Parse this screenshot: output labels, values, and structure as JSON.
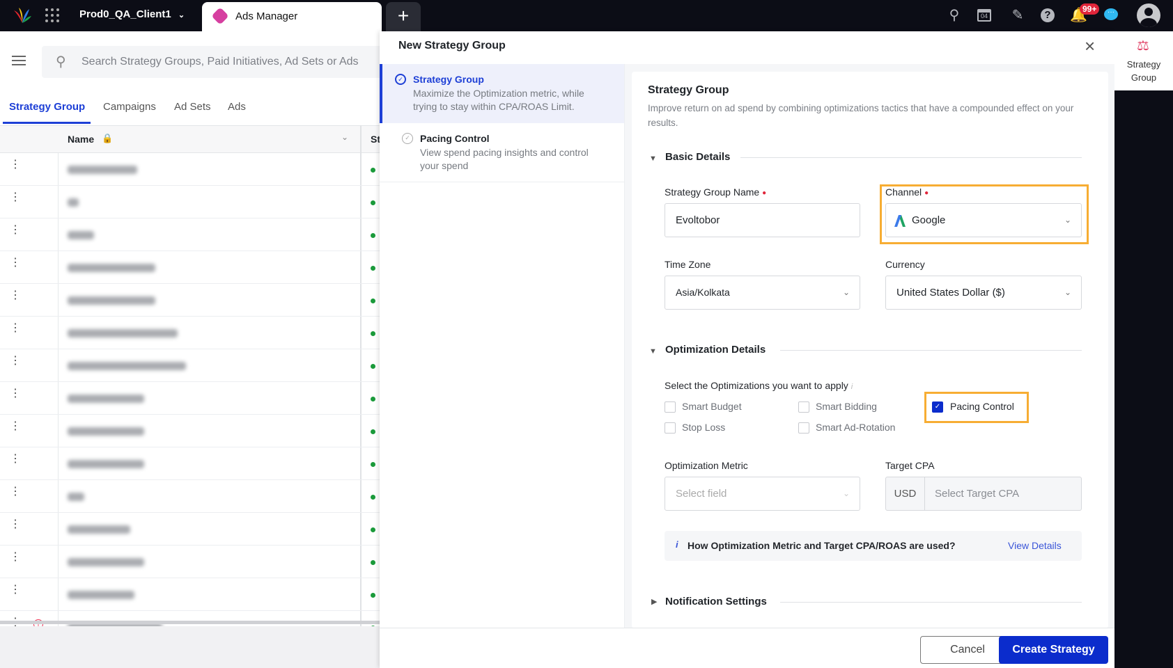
{
  "topbar": {
    "workspace": "Prod0_QA_Client1",
    "active_tab": "Ads Manager",
    "notification_badge": "99+",
    "calendar_day": "04",
    "icons": [
      "logo-icon",
      "apps-grid-icon",
      "search-icon",
      "calendar-icon",
      "pencil-icon",
      "help-icon",
      "bell-icon",
      "chat-icon",
      "avatar-icon"
    ]
  },
  "left": {
    "search_placeholder": "Search Strategy Groups, Paid Initiatives, Ad Sets or Ads",
    "tabs": [
      "Strategy Group",
      "Campaigns",
      "Ad Sets",
      "Ads"
    ],
    "active_tab": 0,
    "column_name": "Name",
    "column_status": "St",
    "row_count_visible": 15,
    "status_color": "#1a9a3a"
  },
  "modal": {
    "title": "New Strategy Group",
    "nav": [
      {
        "title": "Strategy Group",
        "desc": "Maximize the Optimization metric, while trying to stay within CPA/ROAS Limit.",
        "active": true
      },
      {
        "title": "Pacing Control",
        "desc": "View spend pacing insights and control your spend",
        "active": false
      }
    ],
    "card_title": "Strategy Group",
    "card_desc": "Improve return on ad spend by combining optimizations tactics that have a compounded effect on your results.",
    "basic_details": "Basic Details",
    "name_label": "Strategy Group Name",
    "name_value": "Evoltobor",
    "channel_label": "Channel",
    "channel_value": "Google",
    "timezone_label": "Time Zone",
    "timezone_value": "Asia/Kolkata",
    "currency_label": "Currency",
    "currency_value": "United States Dollar ($)",
    "optimization_details": "Optimization Details",
    "select_opts_label": "Select the Optimizations you want to apply",
    "options": [
      {
        "label": "Smart Budget",
        "checked": false
      },
      {
        "label": "Smart Bidding",
        "checked": false
      },
      {
        "label": "Pacing Control",
        "checked": true
      },
      {
        "label": "Stop Loss",
        "checked": false
      },
      {
        "label": "Smart Ad-Rotation",
        "checked": false
      }
    ],
    "metric_label": "Optimization Metric",
    "metric_placeholder": "Select field",
    "target_label": "Target CPA",
    "target_currency": "USD",
    "target_placeholder": "Select Target CPA",
    "info_text": "How Optimization Metric and Target CPA/ROAS are used?",
    "info_link": "View Details",
    "notification_settings": "Notification Settings",
    "cancel": "Cancel",
    "create": "Create Strategy"
  },
  "right_rail": {
    "label": "Strategy Group"
  },
  "colors": {
    "accent": "#0b2ccc",
    "highlight": "#f7ad33",
    "topbar": "#0c0d16"
  }
}
